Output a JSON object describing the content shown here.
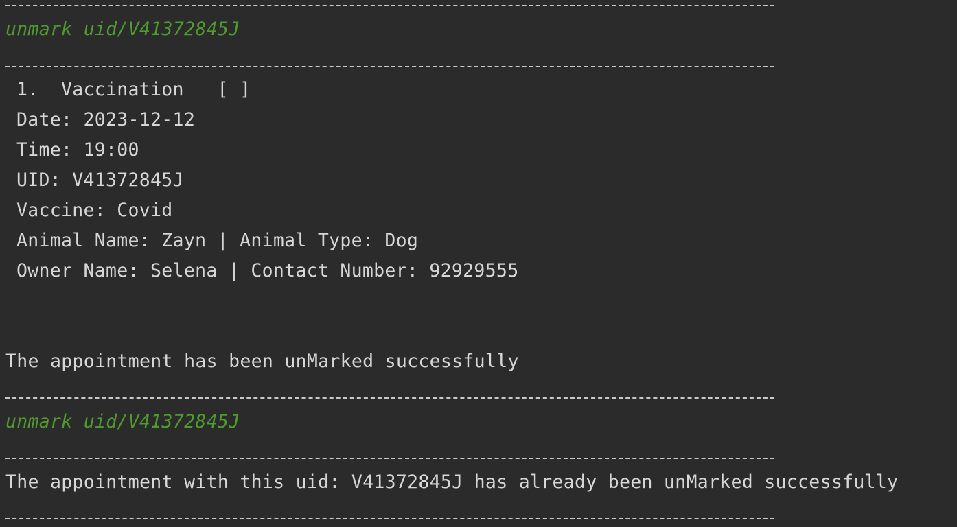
{
  "console": {
    "command_1": "unmark uid/V41372845J",
    "appointment": {
      "index_title": "1.  Vaccination   [ ]",
      "date": "Date: 2023-12-12",
      "time": "Time: 19:00",
      "uid": "UID: V41372845J",
      "vaccine": "Vaccine: Covid",
      "animal": "Animal Name: Zayn | Animal Type: Dog",
      "owner": "Owner Name: Selena | Contact Number: 92929555"
    },
    "message_1": "The appointment has been unMarked successfully",
    "command_2": "unmark uid/V41372845J",
    "message_2": "The appointment with this uid: V41372845J has already been unMarked successfully"
  },
  "colors": {
    "background": "#2b2b2b",
    "text": "#d7d7d7",
    "command": "#4f9b2f",
    "divider": "#c9c9c9"
  }
}
